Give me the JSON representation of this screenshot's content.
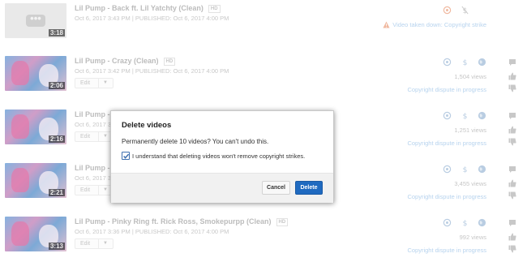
{
  "videos": [
    {
      "title": "Lil Pump - Back ft. Lil Yatchty (Clean)",
      "hd": "HD",
      "meta": "Oct 6, 2017 3:43 PM | PUBLISHED: Oct 6, 2017 4:00 PM",
      "duration": "3:18",
      "status": "Video taken down: Copyright strike"
    },
    {
      "title": "Lil Pump - Crazy (Clean)",
      "hd": "HD",
      "meta": "Oct 6, 2017 3:42 PM | PUBLISHED: Oct 6, 2017 4:00 PM",
      "duration": "2:06",
      "edit": "Edit",
      "views": "1,504 views",
      "status": "Copyright dispute in progress"
    },
    {
      "title": "Lil Pump - S",
      "meta": "Oct 6, 2017 3",
      "duration": "2:16",
      "edit": "Edit",
      "views": "1,251 views",
      "status": "Copyright dispute in progress"
    },
    {
      "title": "Lil Pump - V",
      "meta": "Oct 6, 2017 3",
      "duration": "2:21",
      "edit": "Edit",
      "views": "3,455 views",
      "status": "Copyright dispute in progress"
    },
    {
      "title": "Lil Pump - Pinky Ring ft. Rick Ross, Smokepurpp (Clean)",
      "hd": "HD",
      "meta": "Oct 6, 2017 3:36 PM | PUBLISHED: Oct 6, 2017 4:00 PM",
      "duration": "3:13",
      "edit": "Edit",
      "views": "992 views",
      "status": "Copyright dispute in progress"
    }
  ],
  "dialog": {
    "title": "Delete videos",
    "message": "Permanently delete 10 videos? You can't undo this.",
    "checkbox_label": "I understand that deleting videos won't remove copyright strikes.",
    "checkbox_checked": true,
    "cancel_label": "Cancel",
    "delete_label": "Delete"
  },
  "colors": {
    "accent": "#1f6ac0",
    "dispute_text": "#b7d3ee",
    "takedown_icon": "#f0b9a0",
    "faded_icon": "#b9cde2"
  },
  "icons": {
    "row_icons": [
      "visibility-icon",
      "monetization-icon",
      "globe-icon"
    ],
    "side_icons": [
      "comment-icon",
      "thumbs-up-icon",
      "thumbs-down-icon"
    ]
  }
}
